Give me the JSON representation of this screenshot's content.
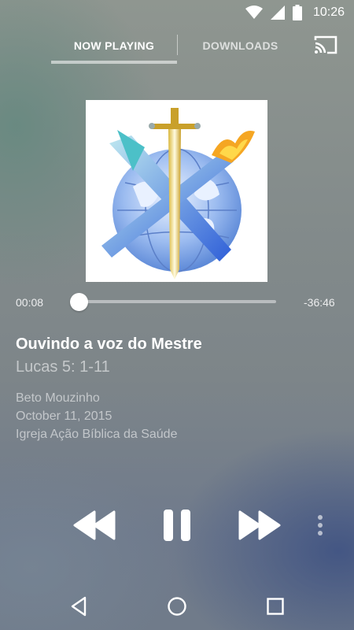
{
  "status_bar": {
    "time": "10:26",
    "icons": [
      "wifi-icon",
      "signal-icon",
      "battery-icon"
    ]
  },
  "tabs": [
    {
      "label": "NOW PLAYING",
      "selected": true
    },
    {
      "label": "DOWNLOADS",
      "selected": false
    }
  ],
  "toolbar": {
    "cast_icon": "cast-icon"
  },
  "artwork": {
    "description_icon": "sermon-artwork-logo"
  },
  "player": {
    "elapsed": "00:08",
    "remaining": "-36:46",
    "progress_fraction": 0.003
  },
  "track": {
    "title": "Ouvindo a voz do Mestre",
    "reference": "Lucas 5: 1-11",
    "speaker": "Beto Mouzinho",
    "date": "October 11, 2015",
    "church": "Igreja Ação Bíblica da Saúde"
  },
  "controls": {
    "rewind_icon": "rewind-icon",
    "pause_icon": "pause-icon",
    "forward_icon": "fast-forward-icon",
    "overflow_icon": "more-vertical-icon"
  },
  "nav_bar": {
    "back_icon": "back-icon",
    "home_icon": "home-icon",
    "recents_icon": "recents-icon"
  }
}
